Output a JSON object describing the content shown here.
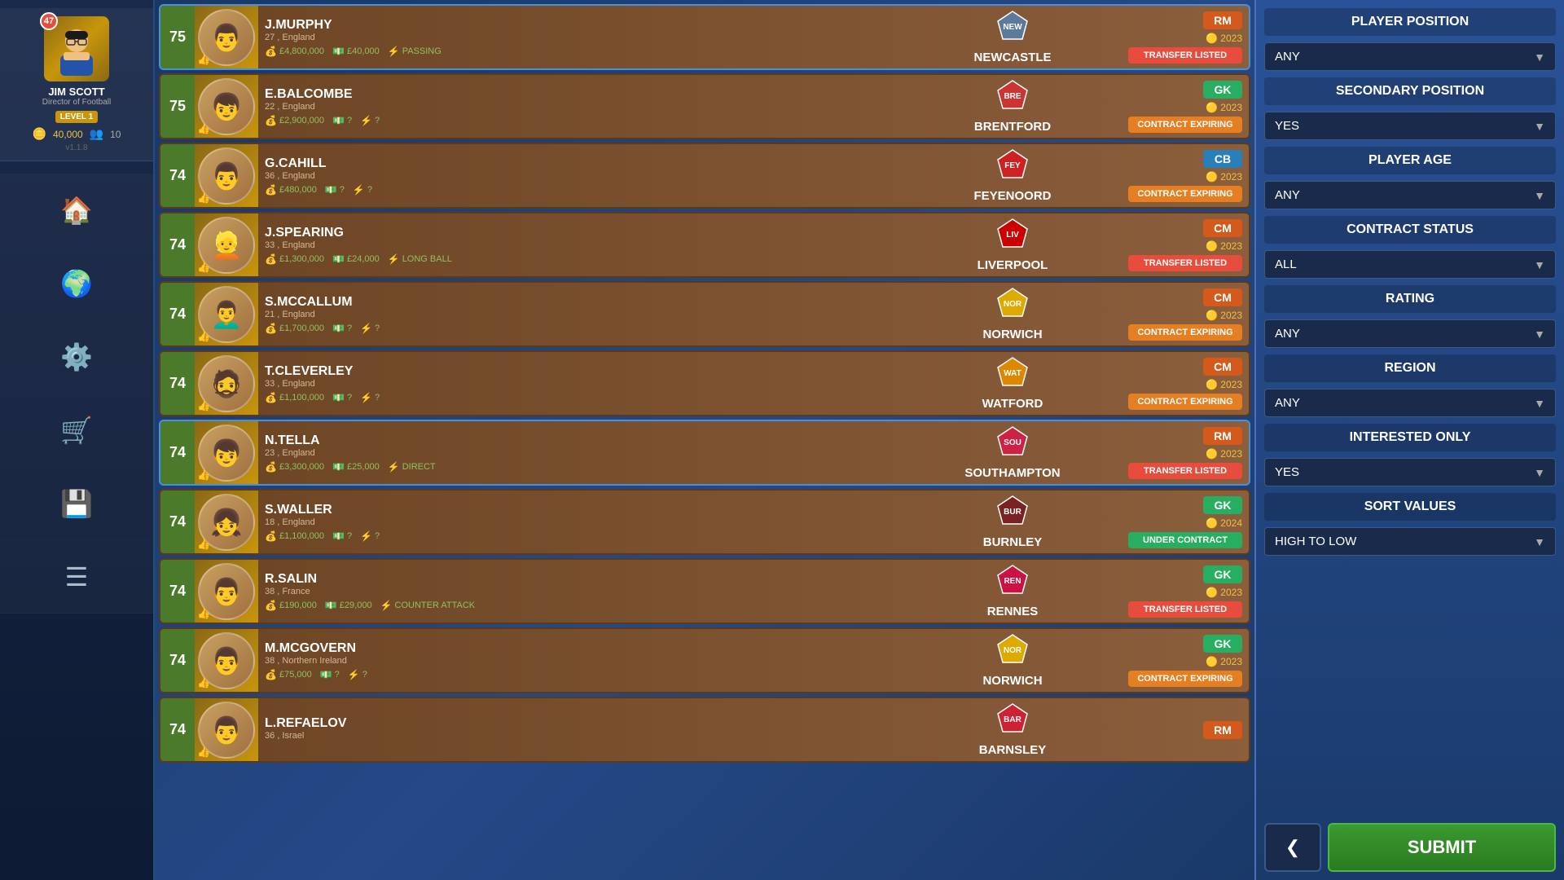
{
  "sidebar": {
    "avatar_level": "47",
    "manager_name": "JIM SCOTT",
    "manager_title": "Director of Football",
    "level_label": "LEVEL 1",
    "coins": "40,000",
    "friends_count": "10",
    "version": "v1.1.8",
    "nav": [
      {
        "icon": "🏠",
        "label": "home"
      },
      {
        "icon": "🌍",
        "label": "world"
      },
      {
        "icon": "⚙️",
        "label": "settings"
      },
      {
        "icon": "🛒",
        "label": "shop"
      },
      {
        "icon": "💾",
        "label": "save"
      },
      {
        "icon": "☰",
        "label": "menu"
      }
    ]
  },
  "players": [
    {
      "rating": "75",
      "name": "J.MURPHY",
      "age": "27",
      "nation": "England",
      "club": "NEWCASTLE",
      "club_icon": "🏟️",
      "position": "RM",
      "pos_class": "pos-rm",
      "value": "£4,800,000",
      "wage": "£40,000",
      "skill": "PASSING",
      "year": "2023",
      "status": "TRANSFER LISTED",
      "status_class": "status-transfer",
      "highlighted": true,
      "face": "👨"
    },
    {
      "rating": "75",
      "name": "E.BALCOMBE",
      "age": "22",
      "nation": "England",
      "club": "BRENTFORD",
      "club_icon": "🔴",
      "position": "GK",
      "pos_class": "pos-gk",
      "value": "£2,900,000",
      "wage": "?",
      "skill": "?",
      "year": "2023",
      "status": "CONTRACT EXPIRING",
      "status_class": "status-expiring",
      "highlighted": false,
      "face": "👦"
    },
    {
      "rating": "74",
      "name": "G.CAHILL",
      "age": "36",
      "nation": "England",
      "club": "FEYENOORD",
      "club_icon": "🔴",
      "position": "CB",
      "pos_class": "pos-cb",
      "value": "£480,000",
      "wage": "?",
      "skill": "?",
      "year": "2023",
      "status": "CONTRACT EXPIRING",
      "status_class": "status-expiring",
      "highlighted": false,
      "face": "👨"
    },
    {
      "rating": "74",
      "name": "J.SPEARING",
      "age": "33",
      "nation": "England",
      "club": "LIVERPOOL",
      "club_icon": "🔴",
      "position": "CM",
      "pos_class": "pos-cm",
      "value": "£1,300,000",
      "wage": "£24,000",
      "skill": "LONG BALL",
      "year": "2023",
      "status": "TRANSFER LISTED",
      "status_class": "status-transfer",
      "highlighted": false,
      "face": "👱"
    },
    {
      "rating": "74",
      "name": "S.MCCALLUM",
      "age": "21",
      "nation": "England",
      "club": "NORWICH",
      "club_icon": "🟡",
      "position": "CM",
      "pos_class": "pos-cm",
      "value": "£1,700,000",
      "wage": "?",
      "skill": "?",
      "year": "2023",
      "status": "CONTRACT EXPIRING",
      "status_class": "status-expiring",
      "highlighted": false,
      "face": "👨‍🦱"
    },
    {
      "rating": "74",
      "name": "T.CLEVERLEY",
      "age": "33",
      "nation": "England",
      "club": "WATFORD",
      "club_icon": "🔶",
      "position": "CM",
      "pos_class": "pos-cm",
      "value": "£1,100,000",
      "wage": "?",
      "skill": "?",
      "year": "2023",
      "status": "CONTRACT EXPIRING",
      "status_class": "status-expiring",
      "highlighted": false,
      "face": "🧔"
    },
    {
      "rating": "74",
      "name": "N.TELLA",
      "age": "23",
      "nation": "England",
      "club": "SOUTHAMPTON",
      "club_icon": "🔴",
      "position": "RM",
      "pos_class": "pos-rm",
      "value": "£3,300,000",
      "wage": "£25,000",
      "skill": "DIRECT",
      "year": "2023",
      "status": "TRANSFER LISTED",
      "status_class": "status-transfer",
      "highlighted": true,
      "face": "👦"
    },
    {
      "rating": "74",
      "name": "S.WALLER",
      "age": "18",
      "nation": "England",
      "club": "BURNLEY",
      "club_icon": "🟤",
      "position": "GK",
      "pos_class": "pos-gk",
      "value": "£1,100,000",
      "wage": "?",
      "skill": "?",
      "year": "2024",
      "status": "UNDER CONTRACT",
      "status_class": "status-contract",
      "highlighted": false,
      "face": "👧"
    },
    {
      "rating": "74",
      "name": "R.SALIN",
      "age": "38",
      "nation": "France",
      "club": "RENNES",
      "club_icon": "🔴",
      "position": "GK",
      "pos_class": "pos-gk",
      "value": "£190,000",
      "wage": "£29,000",
      "skill": "COUNTER ATTACK",
      "year": "2023",
      "status": "TRANSFER LISTED",
      "status_class": "status-transfer",
      "highlighted": false,
      "face": "👨"
    },
    {
      "rating": "74",
      "name": "M.MCGOVERN",
      "age": "38",
      "nation": "Northern Ireland",
      "club": "NORWICH",
      "club_icon": "🟡",
      "position": "GK",
      "pos_class": "pos-gk",
      "value": "£75,000",
      "wage": "?",
      "skill": "?",
      "year": "2023",
      "status": "CONTRACT EXPIRING",
      "status_class": "status-expiring",
      "highlighted": false,
      "face": "👨"
    },
    {
      "rating": "74",
      "name": "L.REFAELOV",
      "age": "36",
      "nation": "Israel",
      "club": "BARNSLEY",
      "club_icon": "🔴",
      "position": "RM",
      "pos_class": "pos-rm",
      "value": "",
      "wage": "",
      "skill": "",
      "year": "",
      "status": "",
      "status_class": "",
      "highlighted": false,
      "face": "👨"
    }
  ],
  "filters": {
    "title": "PLAYER POSITION",
    "position_value": "ANY",
    "secondary_position_title": "SECONDARY POSITION",
    "secondary_position_value": "YES",
    "player_age_title": "PLAYER AGE",
    "player_age_value": "ANY",
    "contract_status_title": "CONTRACT STATUS",
    "contract_status_value": "ALL",
    "rating_title": "RATING",
    "rating_value": "ANY",
    "region_title": "REGION",
    "region_value": "ANY",
    "interested_only_title": "INTERESTED ONLY",
    "interested_only_value": "YES",
    "sort_values_title": "SORT VALUES",
    "sort_values_value": "HIGH TO LOW",
    "submit_label": "SUBMIT",
    "back_icon": "❮"
  }
}
